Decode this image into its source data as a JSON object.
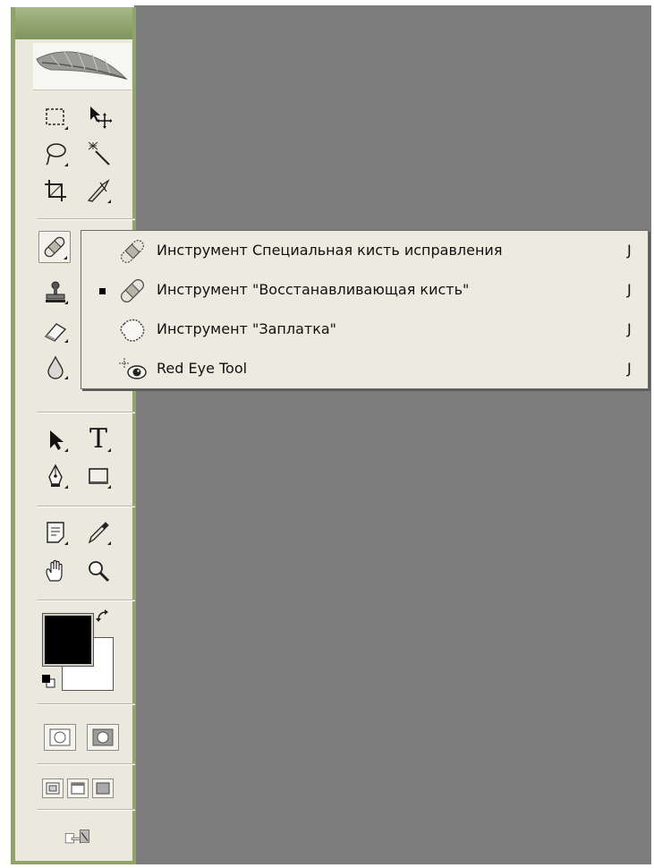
{
  "flyout": {
    "items": [
      {
        "label": "Инструмент Специальная кисть исправления",
        "shortcut": "J",
        "icon": "spot-healing-brush-icon",
        "selected": false
      },
      {
        "label": "Инструмент \"Восстанавливающая кисть\"",
        "shortcut": "J",
        "icon": "healing-brush-icon",
        "selected": true
      },
      {
        "label": "Инструмент \"Заплатка\"",
        "shortcut": "J",
        "icon": "patch-icon",
        "selected": false
      },
      {
        "label": "Red Eye Tool",
        "shortcut": "J",
        "icon": "red-eye-icon",
        "selected": false
      }
    ]
  },
  "toolbox": {
    "tools": [
      "rectangular-marquee-icon",
      "move-icon",
      "lasso-icon",
      "magic-wand-icon",
      "crop-icon",
      "slice-icon",
      "healing-brush-icon",
      "brush-icon",
      "clone-stamp-icon",
      "history-brush-icon",
      "eraser-icon",
      "gradient-icon",
      "blur-icon",
      "dodge-icon",
      "path-selection-icon",
      "type-icon",
      "pen-icon",
      "rectangle-shape-icon",
      "notes-icon",
      "eyedropper-icon",
      "hand-icon",
      "zoom-icon"
    ],
    "text_tool_glyph": "T"
  },
  "colors": {
    "foreground": "#000000",
    "background": "#ffffff",
    "toolbox_bg": "#ebe9dd",
    "frame_green": "#8fa36a",
    "canvas_gray": "#7c7c7c"
  }
}
